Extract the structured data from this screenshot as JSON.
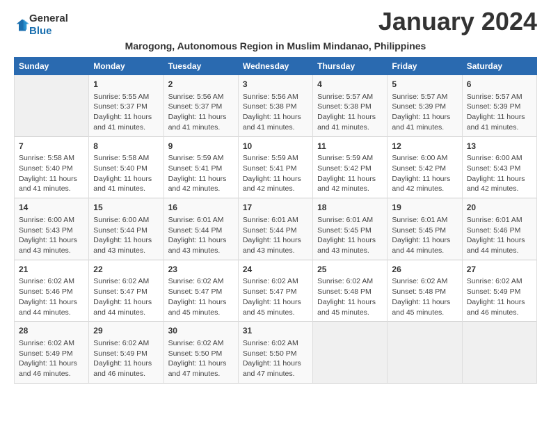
{
  "logo": {
    "general": "General",
    "blue": "Blue"
  },
  "title": "January 2024",
  "subtitle": "Marogong, Autonomous Region in Muslim Mindanao, Philippines",
  "days_of_week": [
    "Sunday",
    "Monday",
    "Tuesday",
    "Wednesday",
    "Thursday",
    "Friday",
    "Saturday"
  ],
  "weeks": [
    [
      {
        "day": "",
        "info": ""
      },
      {
        "day": "1",
        "info": "Sunrise: 5:55 AM\nSunset: 5:37 PM\nDaylight: 11 hours\nand 41 minutes."
      },
      {
        "day": "2",
        "info": "Sunrise: 5:56 AM\nSunset: 5:37 PM\nDaylight: 11 hours\nand 41 minutes."
      },
      {
        "day": "3",
        "info": "Sunrise: 5:56 AM\nSunset: 5:38 PM\nDaylight: 11 hours\nand 41 minutes."
      },
      {
        "day": "4",
        "info": "Sunrise: 5:57 AM\nSunset: 5:38 PM\nDaylight: 11 hours\nand 41 minutes."
      },
      {
        "day": "5",
        "info": "Sunrise: 5:57 AM\nSunset: 5:39 PM\nDaylight: 11 hours\nand 41 minutes."
      },
      {
        "day": "6",
        "info": "Sunrise: 5:57 AM\nSunset: 5:39 PM\nDaylight: 11 hours\nand 41 minutes."
      }
    ],
    [
      {
        "day": "7",
        "info": "Sunrise: 5:58 AM\nSunset: 5:40 PM\nDaylight: 11 hours\nand 41 minutes."
      },
      {
        "day": "8",
        "info": "Sunrise: 5:58 AM\nSunset: 5:40 PM\nDaylight: 11 hours\nand 41 minutes."
      },
      {
        "day": "9",
        "info": "Sunrise: 5:59 AM\nSunset: 5:41 PM\nDaylight: 11 hours\nand 42 minutes."
      },
      {
        "day": "10",
        "info": "Sunrise: 5:59 AM\nSunset: 5:41 PM\nDaylight: 11 hours\nand 42 minutes."
      },
      {
        "day": "11",
        "info": "Sunrise: 5:59 AM\nSunset: 5:42 PM\nDaylight: 11 hours\nand 42 minutes."
      },
      {
        "day": "12",
        "info": "Sunrise: 6:00 AM\nSunset: 5:42 PM\nDaylight: 11 hours\nand 42 minutes."
      },
      {
        "day": "13",
        "info": "Sunrise: 6:00 AM\nSunset: 5:43 PM\nDaylight: 11 hours\nand 42 minutes."
      }
    ],
    [
      {
        "day": "14",
        "info": "Sunrise: 6:00 AM\nSunset: 5:43 PM\nDaylight: 11 hours\nand 43 minutes."
      },
      {
        "day": "15",
        "info": "Sunrise: 6:00 AM\nSunset: 5:44 PM\nDaylight: 11 hours\nand 43 minutes."
      },
      {
        "day": "16",
        "info": "Sunrise: 6:01 AM\nSunset: 5:44 PM\nDaylight: 11 hours\nand 43 minutes."
      },
      {
        "day": "17",
        "info": "Sunrise: 6:01 AM\nSunset: 5:44 PM\nDaylight: 11 hours\nand 43 minutes."
      },
      {
        "day": "18",
        "info": "Sunrise: 6:01 AM\nSunset: 5:45 PM\nDaylight: 11 hours\nand 43 minutes."
      },
      {
        "day": "19",
        "info": "Sunrise: 6:01 AM\nSunset: 5:45 PM\nDaylight: 11 hours\nand 44 minutes."
      },
      {
        "day": "20",
        "info": "Sunrise: 6:01 AM\nSunset: 5:46 PM\nDaylight: 11 hours\nand 44 minutes."
      }
    ],
    [
      {
        "day": "21",
        "info": "Sunrise: 6:02 AM\nSunset: 5:46 PM\nDaylight: 11 hours\nand 44 minutes."
      },
      {
        "day": "22",
        "info": "Sunrise: 6:02 AM\nSunset: 5:47 PM\nDaylight: 11 hours\nand 44 minutes."
      },
      {
        "day": "23",
        "info": "Sunrise: 6:02 AM\nSunset: 5:47 PM\nDaylight: 11 hours\nand 45 minutes."
      },
      {
        "day": "24",
        "info": "Sunrise: 6:02 AM\nSunset: 5:47 PM\nDaylight: 11 hours\nand 45 minutes."
      },
      {
        "day": "25",
        "info": "Sunrise: 6:02 AM\nSunset: 5:48 PM\nDaylight: 11 hours\nand 45 minutes."
      },
      {
        "day": "26",
        "info": "Sunrise: 6:02 AM\nSunset: 5:48 PM\nDaylight: 11 hours\nand 45 minutes."
      },
      {
        "day": "27",
        "info": "Sunrise: 6:02 AM\nSunset: 5:49 PM\nDaylight: 11 hours\nand 46 minutes."
      }
    ],
    [
      {
        "day": "28",
        "info": "Sunrise: 6:02 AM\nSunset: 5:49 PM\nDaylight: 11 hours\nand 46 minutes."
      },
      {
        "day": "29",
        "info": "Sunrise: 6:02 AM\nSunset: 5:49 PM\nDaylight: 11 hours\nand 46 minutes."
      },
      {
        "day": "30",
        "info": "Sunrise: 6:02 AM\nSunset: 5:50 PM\nDaylight: 11 hours\nand 47 minutes."
      },
      {
        "day": "31",
        "info": "Sunrise: 6:02 AM\nSunset: 5:50 PM\nDaylight: 11 hours\nand 47 minutes."
      },
      {
        "day": "",
        "info": ""
      },
      {
        "day": "",
        "info": ""
      },
      {
        "day": "",
        "info": ""
      }
    ]
  ]
}
